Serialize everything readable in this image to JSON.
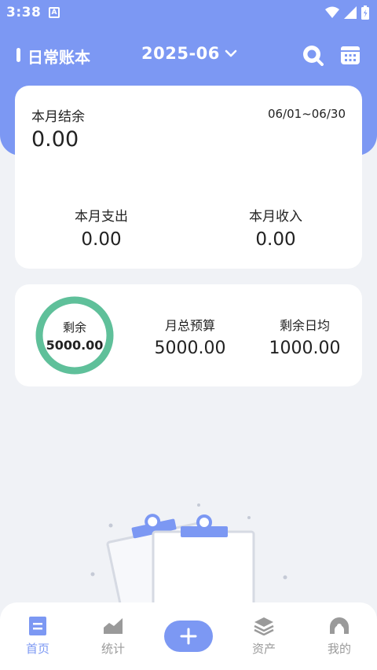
{
  "status_bar": {
    "time": "3:38",
    "app_icon_letter": "A"
  },
  "header": {
    "book_title": "日常账本",
    "month": "2025-06",
    "search_icon": "search-icon",
    "calendar_icon": "calendar-icon"
  },
  "summary": {
    "balance_label": "本月结余",
    "balance_value": "0.00",
    "date_range": "06/01~06/30",
    "expense_label": "本月支出",
    "expense_value": "0.00",
    "income_label": "本月收入",
    "income_value": "0.00"
  },
  "budget": {
    "remaining_label": "剩余",
    "remaining_value": "5000.00",
    "remaining_fraction": 1.0,
    "total_label": "月总预算",
    "total_value": "5000.00",
    "daily_label": "剩余日均",
    "daily_value": "1000.00"
  },
  "bottom_nav": {
    "items": [
      {
        "label": "首页",
        "icon": "home-icon",
        "active": true
      },
      {
        "label": "统计",
        "icon": "chart-icon",
        "active": false
      },
      {
        "label": "资产",
        "icon": "layers-icon",
        "active": false
      },
      {
        "label": "我的",
        "icon": "profile-icon",
        "active": false
      }
    ],
    "add_icon": "plus-icon"
  },
  "colors": {
    "primary": "#7c98f3",
    "ring": "#5fc09a",
    "background": "#f0f2f6"
  }
}
